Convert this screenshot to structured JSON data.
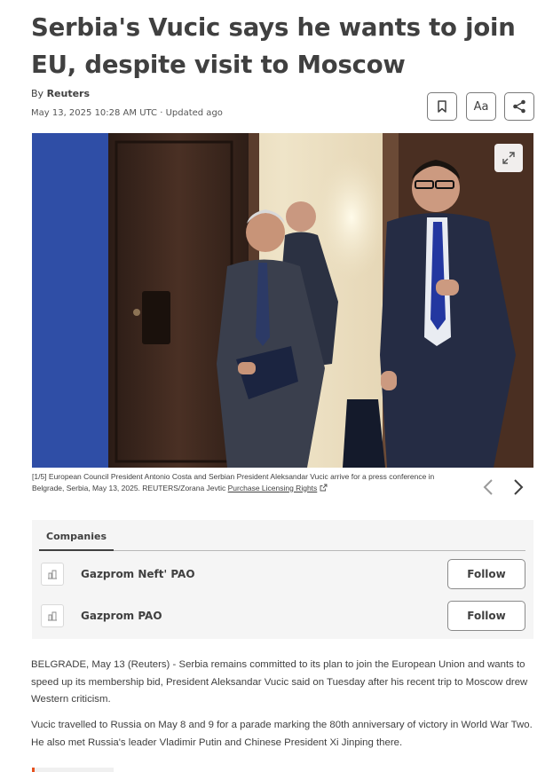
{
  "article": {
    "headline": "Serbia's Vucic says he wants to join EU, despite visit to Moscow",
    "byline_prefix": "By ",
    "author": "Reuters",
    "dateline": "May 13, 2025 10:28 AM UTC · Updated ago"
  },
  "toolbar": {
    "bookmark_icon": "bookmark-icon",
    "text_size_label": "Aa",
    "share_icon": "share-icon"
  },
  "photo": {
    "expand_icon": "expand-icon",
    "caption_counter": "[1/5]",
    "caption_text": " European Council President Antonio Costa and Serbian President Aleksandar Vucic arrive for a press conference in Belgrade, Serbia, May 13, 2025. REUTERS/Zorana Jevtic ",
    "licensing_link": "Purchase Licensing Rights",
    "external_link_icon": "external-link-icon",
    "prev_icon": "chevron-left-icon",
    "next_icon": "chevron-right-icon"
  },
  "companies": {
    "tab_label": "Companies",
    "items": [
      {
        "name": "Gazprom Neft' PAO",
        "follow_label": "Follow",
        "logo_icon": "building-icon"
      },
      {
        "name": "Gazprom PAO",
        "follow_label": "Follow",
        "logo_icon": "building-icon"
      }
    ]
  },
  "body": {
    "paragraphs": [
      "BELGRADE, May 13 (Reuters) - Serbia remains committed to its plan to join the European Union and wants to speed up its membership bid, President Aleksandar Vucic said on Tuesday after his recent trip to Moscow drew Western criticism.",
      "Vucic travelled to Russia on May 8 and 9 for a parade marking the 80th anniversary of victory in World War Two. He also met Russia's leader Vladimir Putin and Chinese President Xi Jinping there."
    ]
  },
  "colors": {
    "text": "#404040",
    "accent": "#e6521f",
    "panel_bg": "#f5f5f5"
  }
}
